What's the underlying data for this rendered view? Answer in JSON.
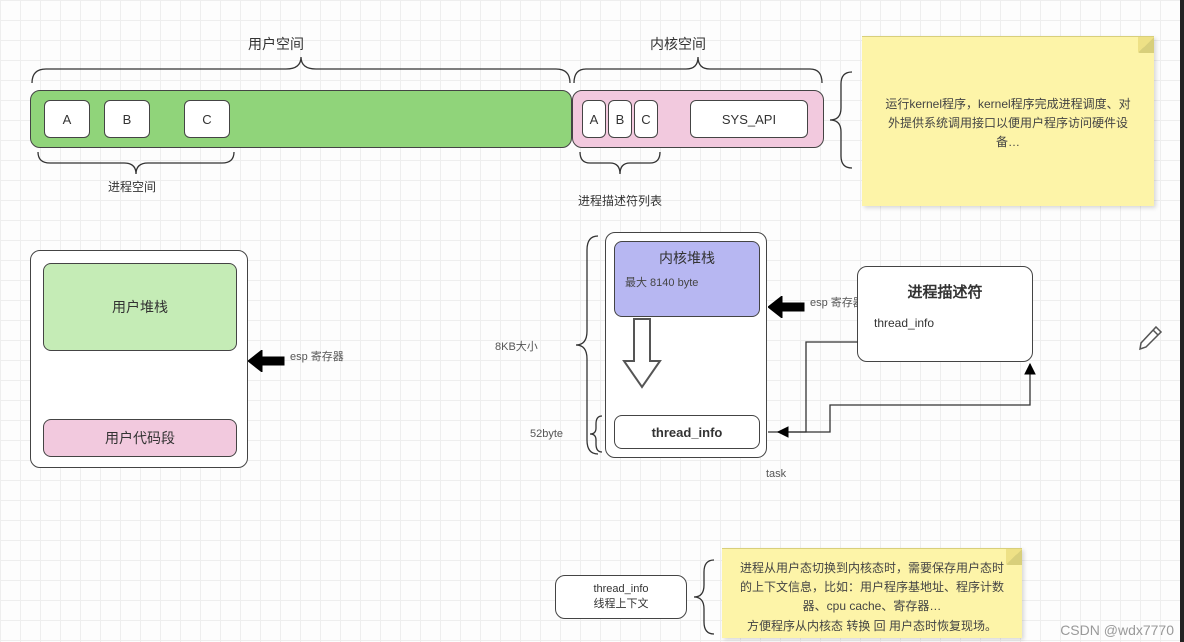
{
  "top": {
    "user_space": "用户空间",
    "kernel_space": "内核空间"
  },
  "user_bar": {
    "blocks": [
      "A",
      "B",
      "C"
    ],
    "caption": "进程空间"
  },
  "kernel_bar": {
    "blocks": [
      "A",
      "B",
      "C"
    ],
    "sys_api": "SYS_API",
    "caption": "进程描述符列表"
  },
  "note_top": "运行kernel程序，kernel程序完成进程调度、对外提供系统调用接口以便用户程序访问硬件设备…",
  "user_panel": {
    "stack": "用户堆栈",
    "code": "用户代码段",
    "esp": "esp 寄存器"
  },
  "kernel_panel": {
    "size_total": "8KB大小",
    "size_thread": "52byte",
    "stack_title": "内核堆栈",
    "stack_sub": "最大 8140 byte",
    "thread_info": "thread_info",
    "esp": "esp 寄存器",
    "task": "task"
  },
  "proc_desc": {
    "title": "进程描述符",
    "field": "thread_info"
  },
  "thread_info_box": {
    "line1": "thread_info",
    "line2": "线程上下文"
  },
  "note_bottom": "进程从用户态切换到内核态时，需要保存用户态时的上下文信息，比如：用户程序基地址、程序计数器、cpu cache、寄存器…\n方便程序从内核态 转换 回 用户态时恢复现场。",
  "watermark": "CSDN @wdx7770"
}
